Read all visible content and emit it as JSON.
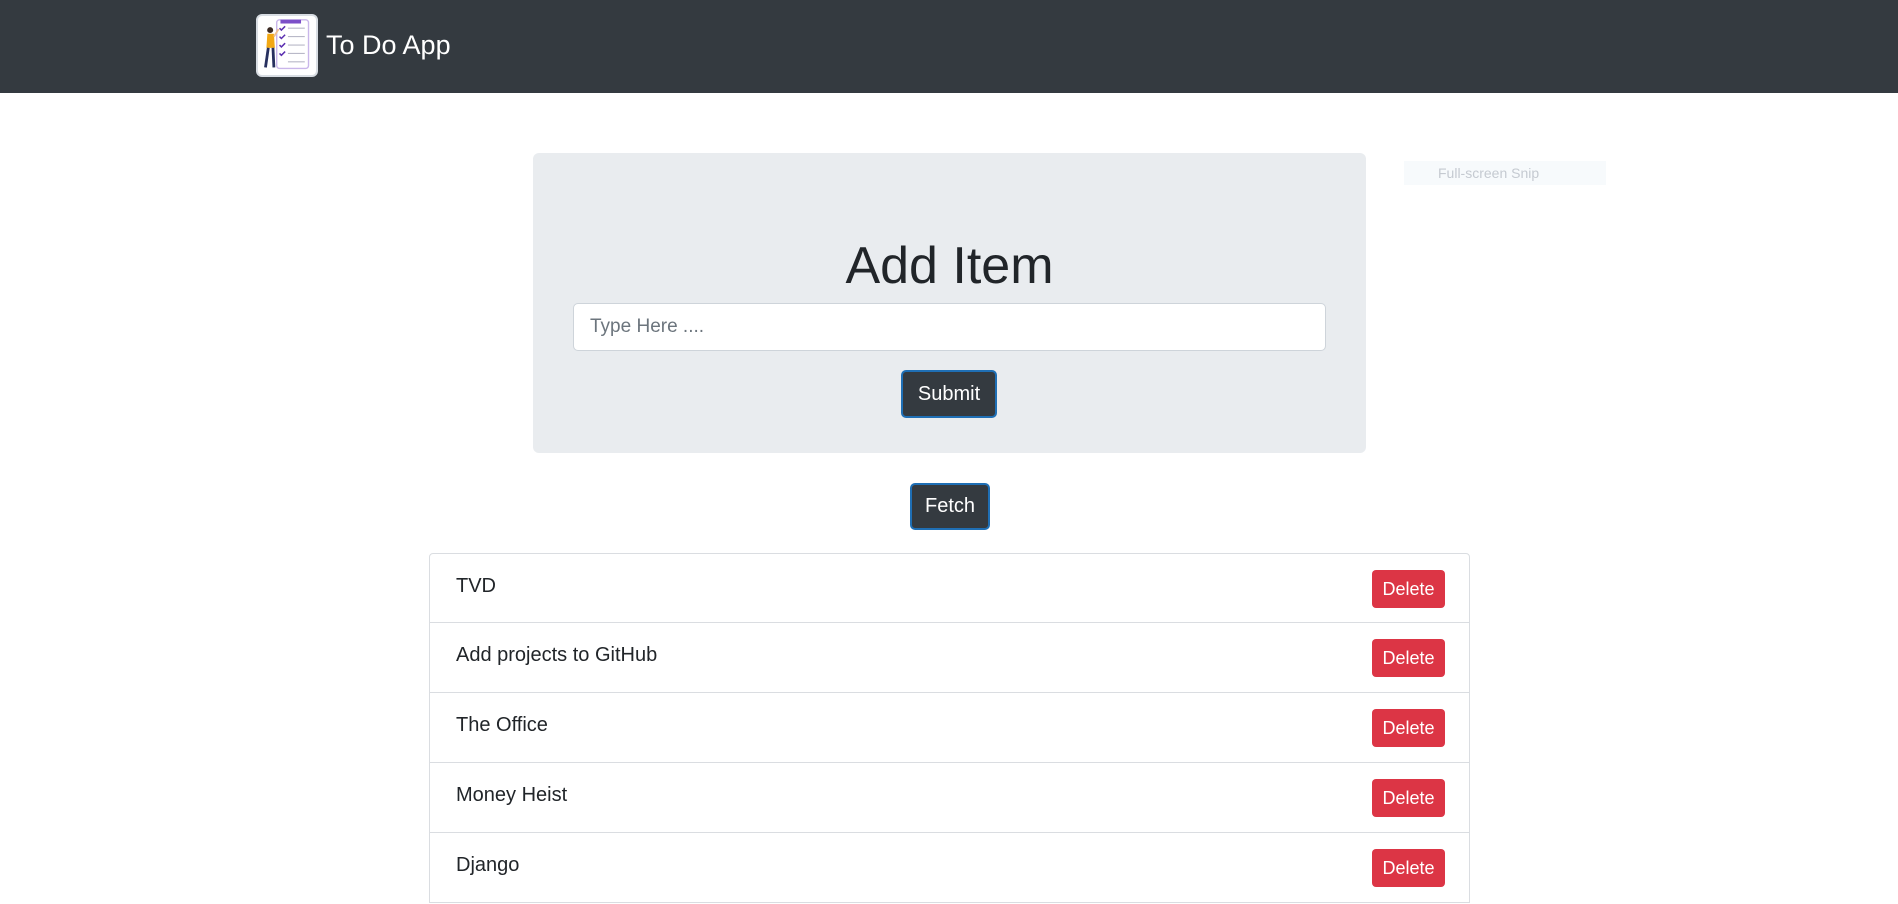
{
  "navbar": {
    "title": "To Do App",
    "logo_icon": "todo-checklist-logo",
    "background": "#343a40"
  },
  "form": {
    "heading": "Add Item",
    "input": {
      "placeholder": "Type Here ....",
      "value": ""
    },
    "submit_label": "Submit"
  },
  "fetch_label": "Fetch",
  "overlay": {
    "label": "Full-screen Snip"
  },
  "items": [
    {
      "text": "TVD",
      "delete_label": "Delete"
    },
    {
      "text": "Add projects to GitHub",
      "delete_label": "Delete"
    },
    {
      "text": "The Office",
      "delete_label": "Delete"
    },
    {
      "text": "Money Heist",
      "delete_label": "Delete"
    },
    {
      "text": "Django",
      "delete_label": "Delete"
    }
  ],
  "colors": {
    "navbar": "#343a40",
    "jumbotron": "#e9ecef",
    "button_dark": "#343a40",
    "button_focus_border": "#1f6fb5",
    "button_danger": "#dc3545"
  }
}
